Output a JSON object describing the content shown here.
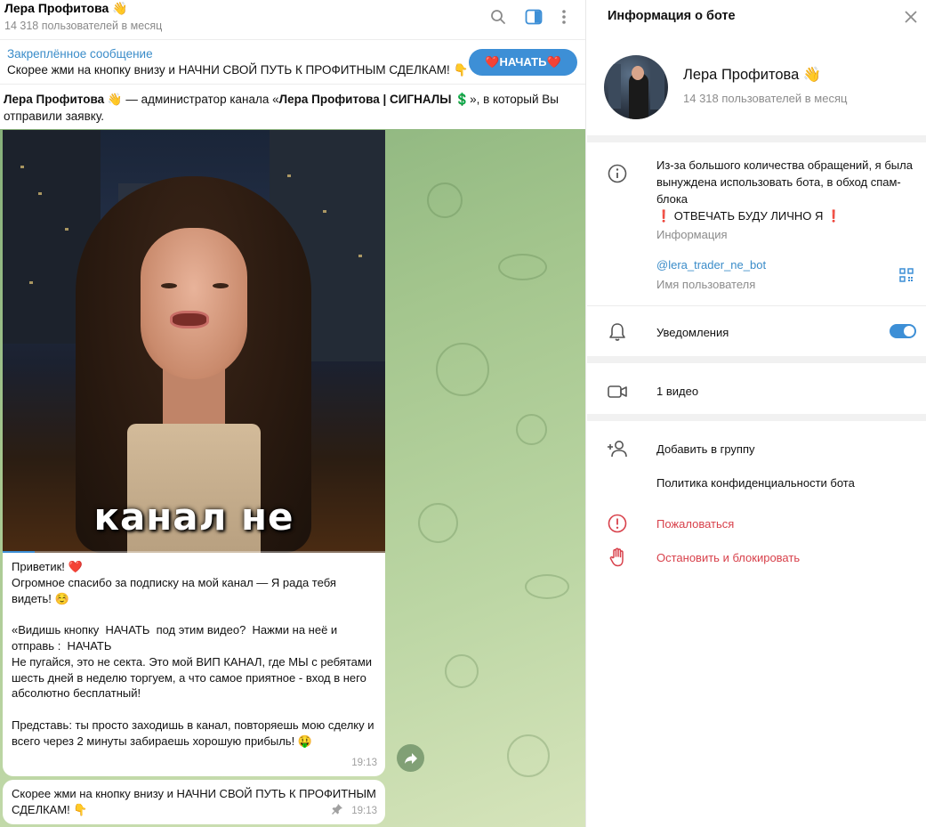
{
  "chat": {
    "title": "Лера Профитова 👋",
    "subtitle": "14 318 пользователей в месяц",
    "header_icons": [
      "search-icon",
      "sidebar-toggle-icon",
      "more-icon"
    ]
  },
  "pinned": {
    "label": "Закреплённое сообщение",
    "text": "Скорее жми на кнопку внизу и НАЧНИ СВОЙ ПУТЬ К ПРОФИТНЫМ СДЕЛКАМ! 👇",
    "button_label": "❤️НАЧАТЬ❤️"
  },
  "notice": {
    "bot_name": "Лера Профитова 👋",
    "middle": " — администратор канала «",
    "channel": "Лера Профитова | СИГНАЛЫ 💲",
    "tail": "», в который Вы отправили заявку."
  },
  "video": {
    "caption": "канал не",
    "progress": 0.08
  },
  "messages": [
    {
      "text": "Приветик! ❤️\nОгромное спасибо за подписку на мой канал — Я рада тебя видеть! ☺️\n\n«Видишь кнопку  НАЧАТЬ  под этим видео?  Нажми на неё и отправь :  НАЧАТЬ\nНе пугайся, это не секта. Это мой ВИП КАНАЛ, где МЫ с ребятами шесть дней в неделю торгуем, а что самое приятное - вход в него абсолютно бесплатный!\n\nПредставь: ты просто заходишь в канал, повторяешь мою сделку и всего через 2 минуты забираешь хорошую прибыль! 🤑",
      "time": "19:13"
    },
    {
      "text": "Скорее жми на кнопку внизу и НАЧНИ СВОЙ ПУТЬ К ПРОФИТНЫМ СДЕЛКАМ! 👇",
      "time": "19:13"
    }
  ],
  "panel": {
    "title": "Информация о боте",
    "name": "Лера Профитова 👋",
    "subtitle": "14 318 пользователей в месяц",
    "info_text": "Из-за большого количества обращений, я была вынуждена использовать бота, в обход спам-блока\n❗ ОТВЕЧАТЬ БУДУ ЛИЧНО Я ❗",
    "info_label": "Информация",
    "username": "@lera_trader_ne_bot",
    "username_label": "Имя пользователя",
    "notifications_label": "Уведомления",
    "notifications_on": true,
    "media_label": "1 видео",
    "add_to_group": "Добавить в группу",
    "privacy_policy": "Политика конфиденциальности бота",
    "report": "Пожаловаться",
    "block": "Остановить и блокировать",
    "accent_color": "#3d8fd6",
    "danger_color": "#d8414b"
  }
}
